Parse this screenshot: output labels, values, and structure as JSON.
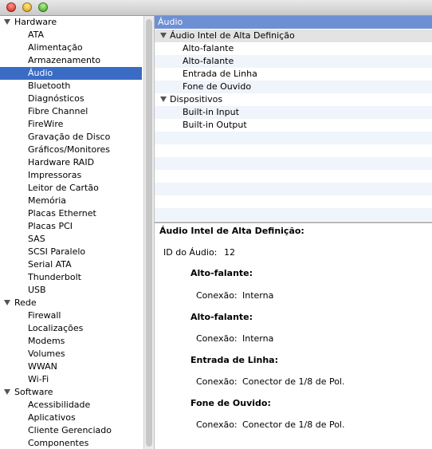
{
  "window": {
    "controls": [
      "close",
      "minimize",
      "zoom"
    ]
  },
  "sidebar": {
    "hardware": {
      "label": "Hardware",
      "items": [
        "ATA",
        "Alimentação",
        "Armazenamento",
        "Áudio",
        "Bluetooth",
        "Diagnósticos",
        "Fibre Channel",
        "FireWire",
        "Gravação de Disco",
        "Gráficos/Monitores",
        "Hardware RAID",
        "Impressoras",
        "Leitor de Cartão",
        "Memória",
        "Placas Ethernet",
        "Placas PCI",
        "SAS",
        "SCSI Paralelo",
        "Serial ATA",
        "Thunderbolt",
        "USB"
      ]
    },
    "rede": {
      "label": "Rede",
      "items": [
        "Firewall",
        "Localizações",
        "Modems",
        "Volumes",
        "WWAN",
        "Wi-Fi"
      ]
    },
    "software": {
      "label": "Software",
      "items": [
        "Acessibilidade",
        "Aplicativos",
        "Cliente Gerenciado",
        "Componentes"
      ]
    },
    "selected": "Áudio"
  },
  "table": {
    "header": "Áudio",
    "group1": {
      "label": "Áudio Intel de Alta Definição",
      "items": [
        "Alto-falante",
        "Alto-falante",
        "Entrada de Linha",
        "Fone de Ouvido"
      ]
    },
    "group2": {
      "label": "Dispositivos",
      "items": [
        "Built-in Input",
        "Built-in Output"
      ]
    }
  },
  "detail": {
    "title": "Áudio Intel de Alta Definição:",
    "id_label": "ID do Áudio:",
    "id_value": "12",
    "sections": [
      {
        "name": "Alto-falante:",
        "conn_label": "Conexão:",
        "conn_value": "Interna"
      },
      {
        "name": "Alto-falante:",
        "conn_label": "Conexão:",
        "conn_value": "Interna"
      },
      {
        "name": "Entrada de Linha:",
        "conn_label": "Conexão:",
        "conn_value": "Conector de 1/8 de Pol."
      },
      {
        "name": "Fone de Ouvido:",
        "conn_label": "Conexão:",
        "conn_value": "Conector de 1/8 de Pol."
      }
    ]
  }
}
